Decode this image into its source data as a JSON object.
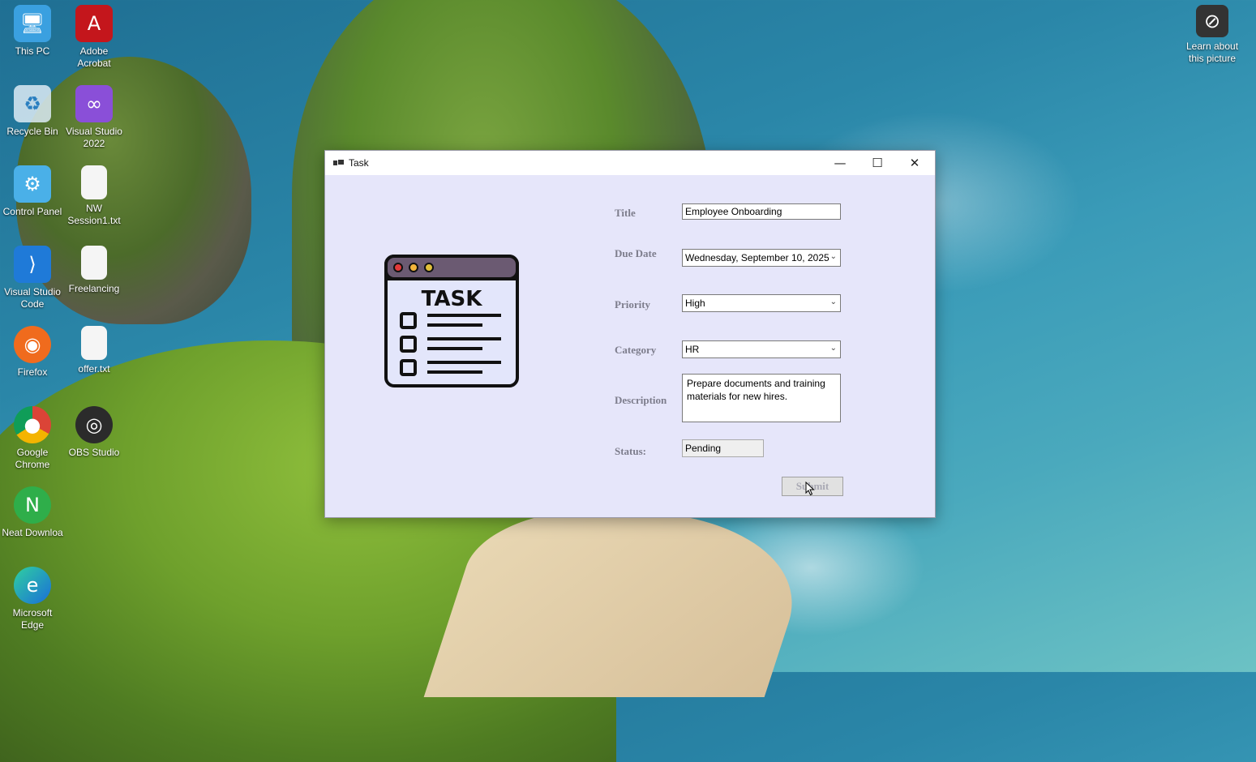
{
  "desktop": {
    "icons": [
      {
        "label": "This PC"
      },
      {
        "label": "Adobe Acrobat"
      },
      {
        "label": "Recycle Bin"
      },
      {
        "label": "Visual Studio 2022"
      },
      {
        "label": "Control Panel"
      },
      {
        "label": "NW Session1.txt"
      },
      {
        "label": "Visual Studio Code"
      },
      {
        "label": "Freelancing"
      },
      {
        "label": "Firefox"
      },
      {
        "label": "offer.txt"
      },
      {
        "label": "Google Chrome"
      },
      {
        "label": "OBS Studio"
      },
      {
        "label": "Neat Downloa"
      },
      {
        "label": "Microsoft Edge"
      }
    ],
    "spotlight_label": "Learn about this picture"
  },
  "window": {
    "title": "Task",
    "controls": {
      "minimize": "—",
      "maximize": "☐",
      "close": "✕"
    },
    "illustration_text": "TASK",
    "form": {
      "title_label": "Title",
      "title_value": "Employee Onboarding",
      "due_date_label": "Due Date",
      "due_date_value": "Wednesday, September 10, 2025",
      "priority_label": "Priority",
      "priority_value": "High",
      "category_label": "Category",
      "category_value": "HR",
      "description_label": "Description",
      "description_value": "Prepare documents and training materials for new hires.",
      "status_label": "Status:",
      "status_value": "Pending",
      "submit_label": "Submit"
    }
  },
  "colors": {
    "form_background": "#e6e6fa",
    "label_color": "#7d7d8c"
  }
}
